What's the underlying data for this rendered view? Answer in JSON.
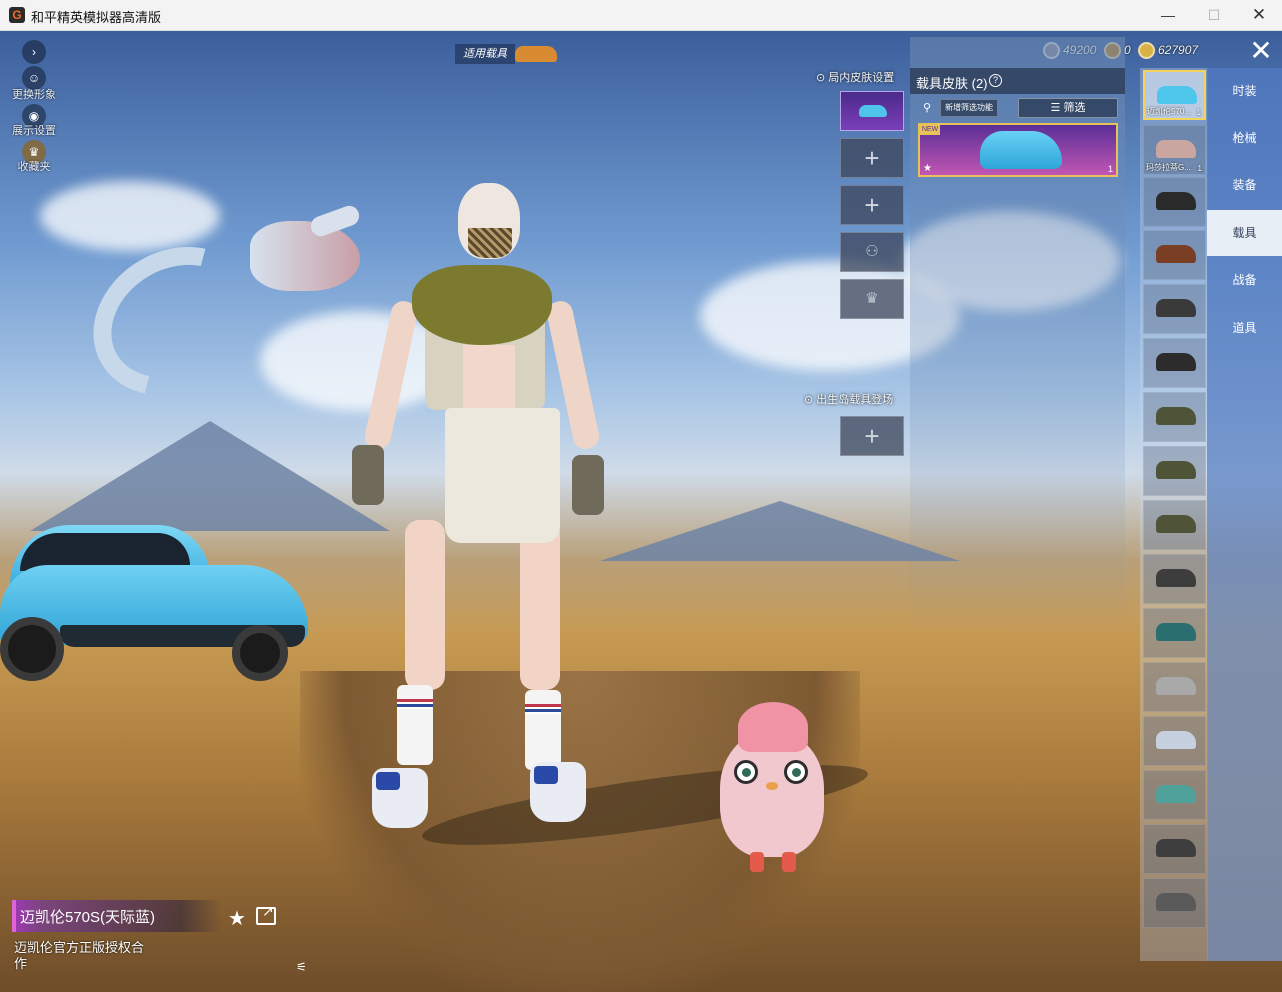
{
  "window": {
    "title": "和平精英模拟器高清版",
    "app_icon": "G",
    "minimize": "—",
    "maximize": "☐",
    "close": "✕"
  },
  "left_menu": {
    "expand_icon": "chevron-right-icon",
    "items": [
      {
        "label": "更换形象",
        "icon": "avatar-icon"
      },
      {
        "label": "展示设置",
        "icon": "eye-icon"
      },
      {
        "label": "收藏夹",
        "icon": "crown-badge-icon"
      }
    ]
  },
  "top_bar": {
    "applied_vehicle_label": "适用载具",
    "currencies": [
      {
        "name": "silver-coin-icon",
        "value": "49200",
        "color": "#7e8494"
      },
      {
        "name": "medal-coin-icon",
        "value": "0",
        "color": "#b07a22"
      },
      {
        "name": "gold-coin-icon",
        "value": "627907",
        "color": "#d8b246"
      }
    ],
    "close_icon": "close-x-icon"
  },
  "in_match_skin": {
    "heading": "局内皮肤设置",
    "add_symbol": "+",
    "lock_symbols": [
      "⚇",
      "♛"
    ]
  },
  "spawn": {
    "heading": "出生岛载具登场"
  },
  "skin_panel": {
    "title": "载具皮肤 (2)",
    "help_icon": "?",
    "search_icon": "⚲",
    "new_filter_label": "新增筛选功能",
    "filter_label": "筛选",
    "card": {
      "badge": "NEW",
      "star": "★",
      "count": "1"
    }
  },
  "vehicle_list": [
    {
      "label": "迈凯伦570...",
      "count": "1",
      "color": "#4ec6ec",
      "active": true
    },
    {
      "label": "玛莎拉蒂G...",
      "count": "1",
      "color": "#c9a7a0",
      "active": false
    },
    {
      "label": "",
      "count": "",
      "color": "#2a2a2a",
      "active": false
    },
    {
      "label": "",
      "count": "",
      "color": "#7a3e24",
      "active": false
    },
    {
      "label": "",
      "count": "",
      "color": "#3a3a3a",
      "active": false
    },
    {
      "label": "",
      "count": "",
      "color": "#2c2c2c",
      "active": false
    },
    {
      "label": "",
      "count": "",
      "color": "#4f5438",
      "active": false
    },
    {
      "label": "",
      "count": "",
      "color": "#4f5438",
      "active": false
    },
    {
      "label": "",
      "count": "",
      "color": "#4f5438",
      "active": false
    },
    {
      "label": "",
      "count": "",
      "color": "#3d3d3d",
      "active": false
    },
    {
      "label": "",
      "count": "",
      "color": "#2b6e6f",
      "active": false
    },
    {
      "label": "",
      "count": "",
      "color": "#a9a9a9",
      "active": false
    },
    {
      "label": "",
      "count": "",
      "color": "#c7d0df",
      "active": false
    },
    {
      "label": "",
      "count": "",
      "color": "#4fa29a",
      "active": false
    },
    {
      "label": "",
      "count": "",
      "color": "#3e3e3e",
      "active": false
    },
    {
      "label": "",
      "count": "",
      "color": "#5a5a5a",
      "active": false
    }
  ],
  "tabs": [
    {
      "label": "时装",
      "active": false
    },
    {
      "label": "枪械",
      "active": false
    },
    {
      "label": "装备",
      "active": false
    },
    {
      "label": "载具",
      "active": true
    },
    {
      "label": "战备",
      "active": false
    },
    {
      "label": "道具",
      "active": false
    }
  ],
  "vehicle_info": {
    "name": "迈凯伦570S(天际蓝)",
    "description": "迈凯伦官方正版授权合作",
    "favorite_icon": "★",
    "share_icon": "share-icon",
    "horn_icon": "⚟"
  }
}
